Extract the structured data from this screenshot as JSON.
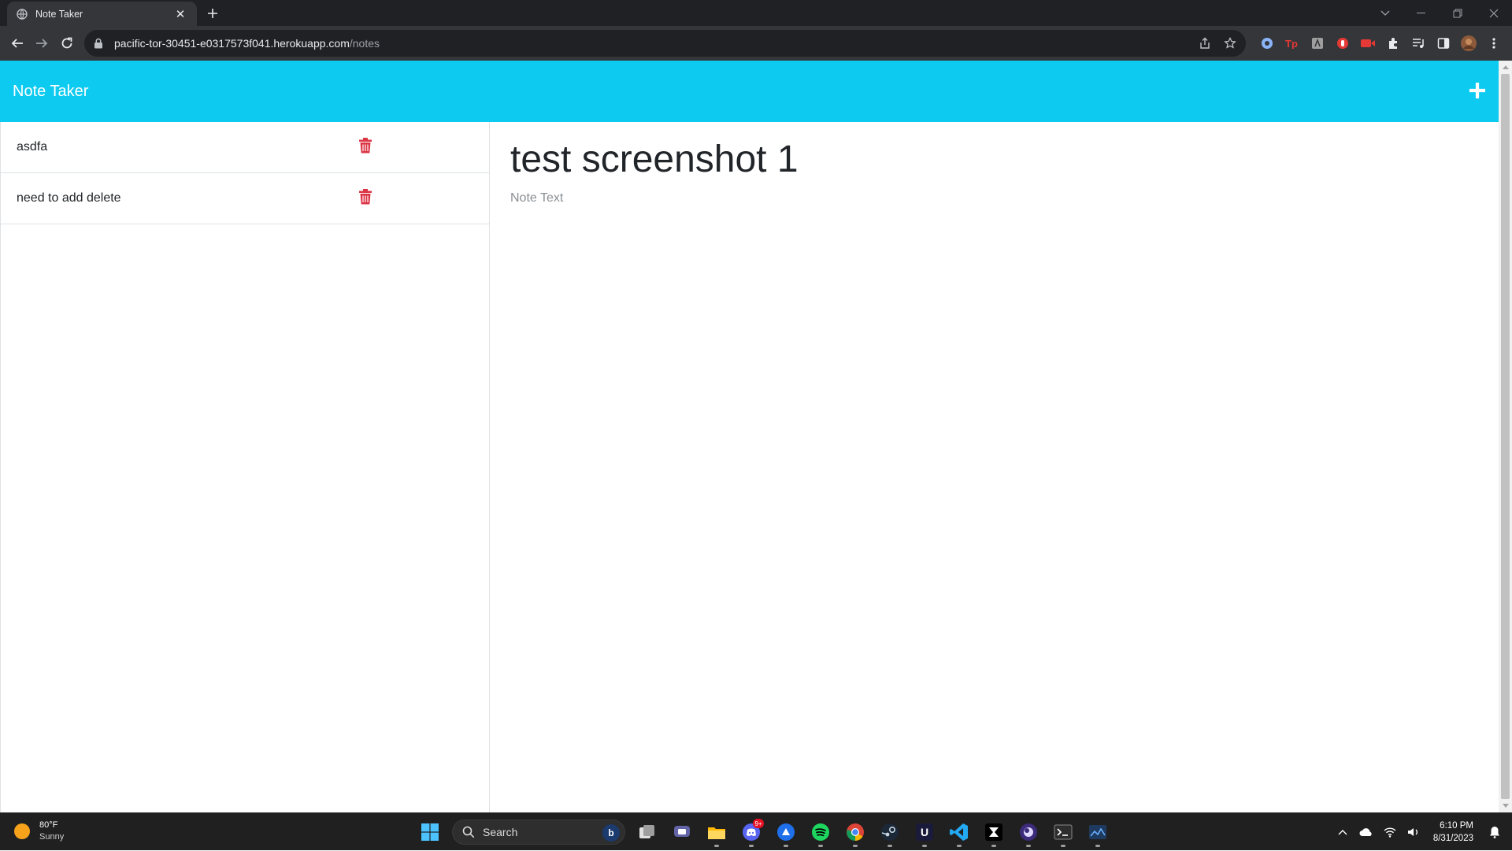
{
  "browser": {
    "tab_title": "Note Taker",
    "url_host": "pacific-tor-30451-e0317573f041.herokuapp.com",
    "url_path": "/notes"
  },
  "app": {
    "brand": "Note Taker",
    "accent_color": "#0dcaf0",
    "delete_color": "#dc3545",
    "notes": [
      {
        "title": "asdfa"
      },
      {
        "title": "need to add delete"
      }
    ],
    "active_note": {
      "title": "test screenshot 1",
      "text": "",
      "text_placeholder": "Note Text"
    }
  },
  "taskbar": {
    "weather": {
      "temp": "80°F",
      "condition": "Sunny"
    },
    "search_label": "Search",
    "discord_badge": "9+",
    "clock": {
      "time": "6:10 PM",
      "date": "8/31/2023"
    }
  }
}
